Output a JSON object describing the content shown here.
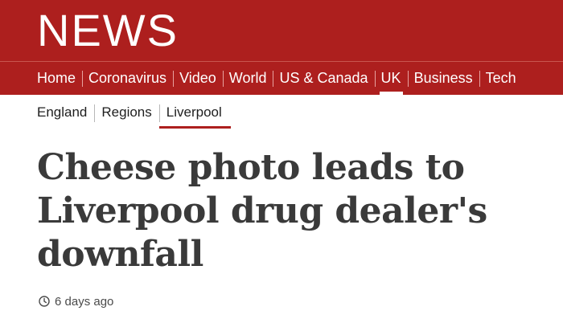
{
  "masthead": {
    "brand": "NEWS"
  },
  "nav": {
    "items": [
      {
        "label": "Home",
        "active": false
      },
      {
        "label": "Coronavirus",
        "active": false
      },
      {
        "label": "Video",
        "active": false
      },
      {
        "label": "World",
        "active": false
      },
      {
        "label": "US & Canada",
        "active": false
      },
      {
        "label": "UK",
        "active": true
      },
      {
        "label": "Business",
        "active": false
      },
      {
        "label": "Tech",
        "active": false
      }
    ]
  },
  "subnav": {
    "items": [
      {
        "label": "England",
        "active": false
      },
      {
        "label": "Regions",
        "active": false
      },
      {
        "label": "Liverpool",
        "active": true
      }
    ]
  },
  "article": {
    "headline": "Cheese photo leads to Liverpool drug dealer's downfall",
    "timestamp": "6 days ago"
  },
  "icons": {
    "timestamp_icon": "clock-icon"
  },
  "colors": {
    "brand_red": "#ad1f1e",
    "headline_text": "#3a3a3a"
  }
}
